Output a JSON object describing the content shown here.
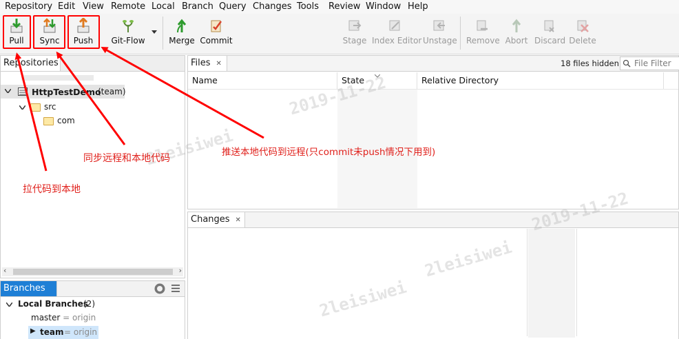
{
  "menu": [
    "Repository",
    "Edit",
    "View",
    "Remote",
    "Local",
    "Branch",
    "Query",
    "Changes",
    "Tools",
    "Review",
    "Window",
    "Help"
  ],
  "toolbar": {
    "pull": "Pull",
    "sync": "Sync",
    "push": "Push",
    "gitflow": "Git-Flow",
    "merge": "Merge",
    "commit": "Commit",
    "stage": "Stage",
    "index_editor": "Index Editor",
    "unstage": "Unstage",
    "remove": "Remove",
    "abort": "Abort",
    "discard": "Discard",
    "delete": "Delete"
  },
  "repos": {
    "tab": "Repositories",
    "repo_name": "HttpTestDemo",
    "repo_branch": "(team)",
    "folder1": "src",
    "folder2": "com"
  },
  "files": {
    "tab": "Files",
    "hidden": "18 files hidden",
    "filter_placeholder": "File Filter",
    "col_name": "Name",
    "col_state": "State",
    "col_reldir": "Relative Directory"
  },
  "changes": {
    "tab": "Changes"
  },
  "branches": {
    "tab": "Branches",
    "local_label": "Local Branches",
    "local_count": "(2)",
    "master": "master",
    "master_remote": "= origin",
    "team": "team",
    "team_remote": "= origin"
  },
  "annotations": {
    "pull": "拉代码到本地",
    "sync": "同步远程和本地代码",
    "push": "推送本地代码到远程(只commit未push情况下用到)"
  },
  "watermark": {
    "date": "2019-11-22",
    "author": "2leisiwei"
  },
  "colors": {
    "annotation_red": "#ff0000",
    "tab_blue": "#1e7fd6",
    "selection": "#cfe6fb"
  }
}
